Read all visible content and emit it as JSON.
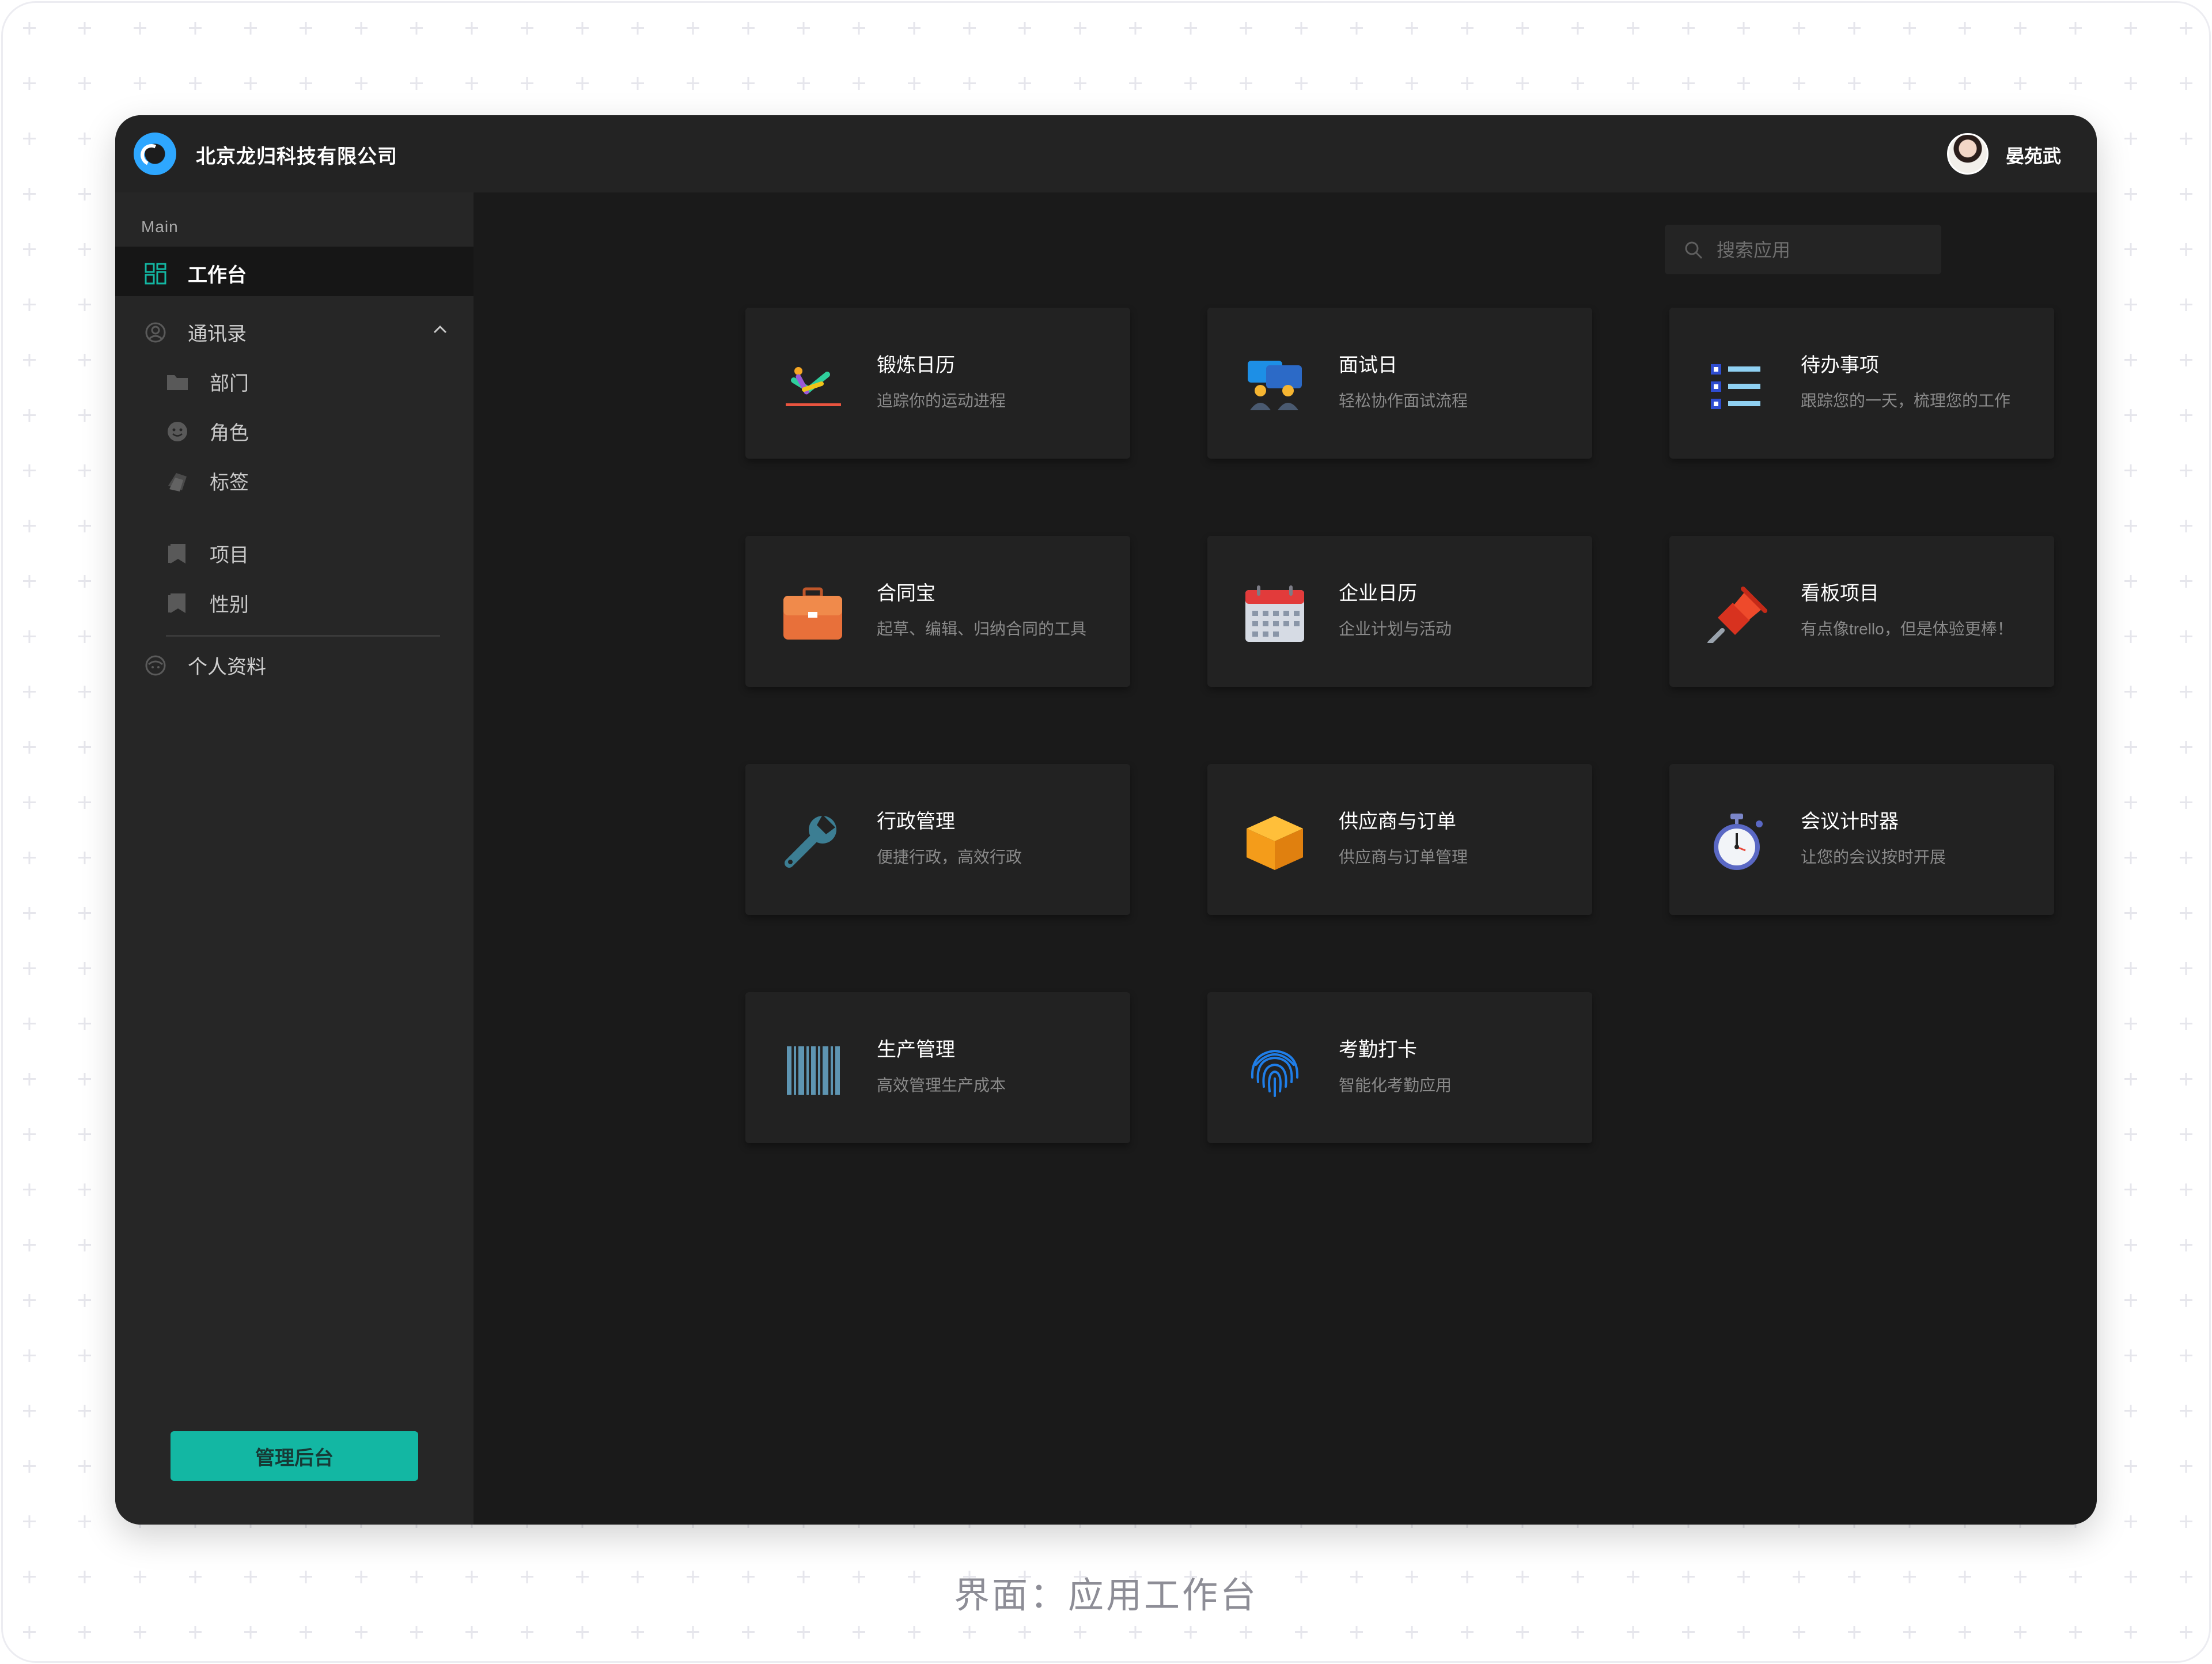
{
  "header": {
    "company": "北京龙归科技有限公司",
    "user_name": "晏苑武"
  },
  "sidebar": {
    "section_label": "Main",
    "items": [
      {
        "label": "工作台",
        "icon": "dashboard-icon",
        "active": true
      },
      {
        "label": "通讯录",
        "icon": "user-circle-icon",
        "expanded": true
      },
      {
        "label": "部门",
        "icon": "folder-icon"
      },
      {
        "label": "角色",
        "icon": "face-icon"
      },
      {
        "label": "标签",
        "icon": "tags-icon"
      },
      {
        "label": "项目",
        "icon": "bookmark-icon"
      },
      {
        "label": "性别",
        "icon": "bookmark-icon"
      },
      {
        "label": "个人资料",
        "icon": "profile-icon"
      }
    ],
    "admin_button": "管理后台"
  },
  "search": {
    "placeholder": "搜索应用"
  },
  "apps": [
    {
      "title": "锻炼日历",
      "desc": "追踪你的运动进程",
      "icon": "exercise-icon"
    },
    {
      "title": "面试日",
      "desc": "轻松协作面试流程",
      "icon": "interview-icon"
    },
    {
      "title": "待办事项",
      "desc": "跟踪您的一天，梳理您的工作",
      "icon": "todo-list-icon"
    },
    {
      "title": "合同宝",
      "desc": "起草、编辑、归纳合同的工具",
      "icon": "briefcase-icon"
    },
    {
      "title": "企业日历",
      "desc": "企业计划与活动",
      "icon": "calendar-icon"
    },
    {
      "title": "看板项目",
      "desc": "有点像trello，但是体验更棒！",
      "icon": "pushpin-icon"
    },
    {
      "title": "行政管理",
      "desc": "便捷行政，高效行政",
      "icon": "wrench-icon"
    },
    {
      "title": "供应商与订单",
      "desc": "供应商与订单管理",
      "icon": "box-icon"
    },
    {
      "title": "会议计时器",
      "desc": "让您的会议按时开展",
      "icon": "stopwatch-icon"
    },
    {
      "title": "生产管理",
      "desc": "高效管理生产成本",
      "icon": "barcode-icon"
    },
    {
      "title": "考勤打卡",
      "desc": "智能化考勤应用",
      "icon": "fingerprint-icon"
    }
  ],
  "caption": "界面：应用工作台",
  "colors": {
    "accent": "#13b7a3",
    "background": "#1a1a1a",
    "card": "#222222",
    "sidebar": "#262626"
  }
}
